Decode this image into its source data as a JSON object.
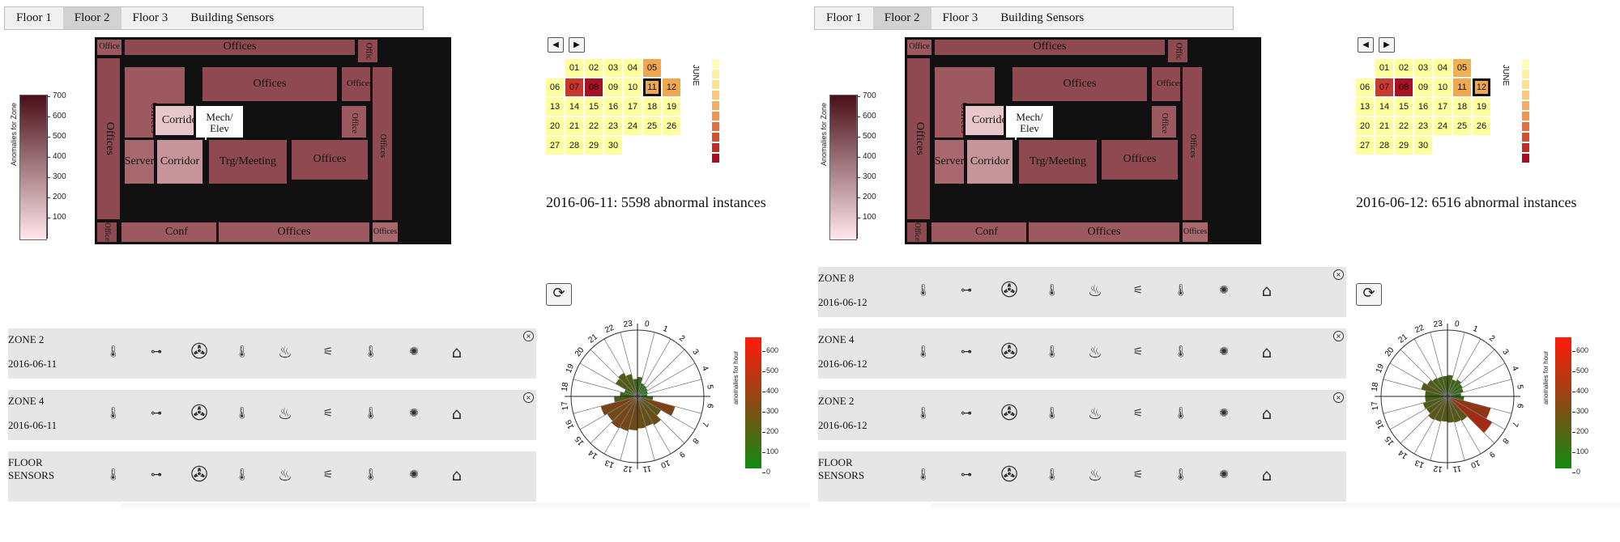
{
  "accent": {
    "zone_red": "#8e4a50",
    "calendar_yellow": "#ffff9e",
    "radial_green": "#1c7a1c",
    "radial_red": "#d11010"
  },
  "tabs": [
    "Floor 1",
    "Floor 2",
    "Floor 3",
    "Building Sensors"
  ],
  "active_tab": "Floor 2",
  "legend": {
    "label": "Anomalies for Zone",
    "ticks": [
      "700",
      "600",
      "500",
      "400",
      "300",
      "200",
      "100"
    ]
  },
  "floorplan_labels": {
    "office_tl": "Office",
    "offices_top": "Offices",
    "office_tr": "Offic",
    "offices_left": "Offices",
    "offices_inner": "Offices",
    "offices_mid": "Offices",
    "offices_small": "Offices",
    "corridor_a": "Corridor",
    "mech": "Mech/ Elev",
    "office_v1": "Office",
    "offices_right": "Offices",
    "server": "Server",
    "corridor_b": "Corridor",
    "trg": "Trg/Meeting",
    "offices_br": "Offices",
    "office_bl": "Office",
    "conf": "Conf",
    "offices_bottom": "Offices",
    "offices_brc": "Offices"
  },
  "calendar": {
    "month": "JUNE",
    "days": [
      "01",
      "02",
      "03",
      "04",
      "05",
      "06",
      "07",
      "08",
      "09",
      "10",
      "11",
      "12",
      "13",
      "14",
      "15",
      "16",
      "17",
      "18",
      "19",
      "20",
      "21",
      "22",
      "23",
      "24",
      "25",
      "26",
      "27",
      "28",
      "29",
      "30"
    ]
  },
  "radial_legend": {
    "label": "anomalies for hour",
    "ticks": [
      "600",
      "500",
      "400",
      "300",
      "200",
      "100",
      "0"
    ]
  },
  "hours": [
    "0",
    "1",
    "2",
    "3",
    "4",
    "5",
    "6",
    "7",
    "8",
    "9",
    "10",
    "11",
    "12",
    "13",
    "14",
    "15",
    "16",
    "17",
    "18",
    "19",
    "20",
    "21",
    "22",
    "23"
  ],
  "sensor_icons": [
    "thermometer-icon",
    "damper-icon",
    "fan-coil-icon",
    "temperature-icon",
    "heater-icon",
    "water-heater-icon",
    "setpoint-icon",
    "fan-icon",
    "ceiling-diffuser-icon"
  ],
  "panels": [
    {
      "selected_day": "11",
      "abnormal_text": "2016-06-11: 5598 abnormal instances",
      "zones": [
        {
          "title": "ZONE 2",
          "date": "2016-06-11",
          "close": "×"
        },
        {
          "title": "ZONE 4",
          "date": "2016-06-11",
          "close": "×"
        },
        {
          "title": "FLOOR SENSORS",
          "date": ""
        }
      ],
      "radial_values": [
        120,
        60,
        50,
        40,
        30,
        20,
        80,
        320,
        200,
        260,
        240,
        250,
        270,
        290,
        300,
        280,
        310,
        160,
        100,
        60,
        180,
        200,
        160,
        100
      ]
    },
    {
      "selected_day": "12",
      "abnormal_text": "2016-06-12: 6516 abnormal instances",
      "zones": [
        {
          "title": "ZONE 8",
          "date": "2016-06-12",
          "close": "×"
        },
        {
          "title": "ZONE 4",
          "date": "2016-06-12",
          "close": "×"
        },
        {
          "title": "ZONE 2",
          "date": "2016-06-12",
          "close": "×"
        },
        {
          "title": "FLOOR SENSORS",
          "date": ""
        }
      ],
      "radial_values": [
        140,
        100,
        120,
        100,
        90,
        60,
        90,
        380,
        450,
        210,
        200,
        190,
        180,
        190,
        200,
        170,
        180,
        150,
        150,
        200,
        160,
        140,
        130,
        130
      ]
    }
  ]
}
